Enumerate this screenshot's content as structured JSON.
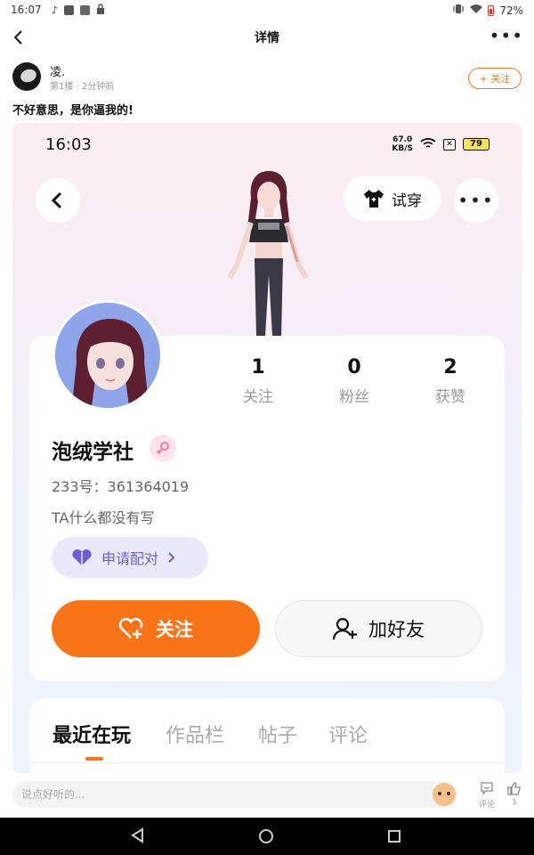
{
  "status_bar": {
    "time": "16:07",
    "battery": "72%"
  },
  "app_bar": {
    "title": "详情"
  },
  "post": {
    "author": "凌.",
    "floor": "第1楼",
    "separator": "·",
    "time_ago": "2分钟前",
    "follow_label": "+ 关注",
    "text": "不好意思，是你逼我的!"
  },
  "embedded": {
    "status_time": "16:03",
    "speed_value": "67.0",
    "speed_unit": "KB/S",
    "battery": "79",
    "try_on_label": "试穿",
    "stats": [
      {
        "value": "1",
        "label": "关注"
      },
      {
        "value": "0",
        "label": "粉丝"
      },
      {
        "value": "2",
        "label": "获赞"
      }
    ],
    "username": "泡绒学社",
    "uid_label": "233号：",
    "uid_value": "361364019",
    "bio": "TA什么都没有写",
    "pair_label": "申请配对",
    "follow_button": "关注",
    "add_friend_button": "加好友",
    "tabs": [
      "最近在玩",
      "作品栏",
      "帖子",
      "评论"
    ],
    "active_tab": "最近在玩"
  },
  "comment_bar": {
    "placeholder": "说点好听的...",
    "comment_label": "评论",
    "like_count": "1"
  },
  "colors": {
    "accent": "#f97417",
    "pair_purple": "#6b5fd8",
    "follow_outline": "#f07a2a"
  }
}
